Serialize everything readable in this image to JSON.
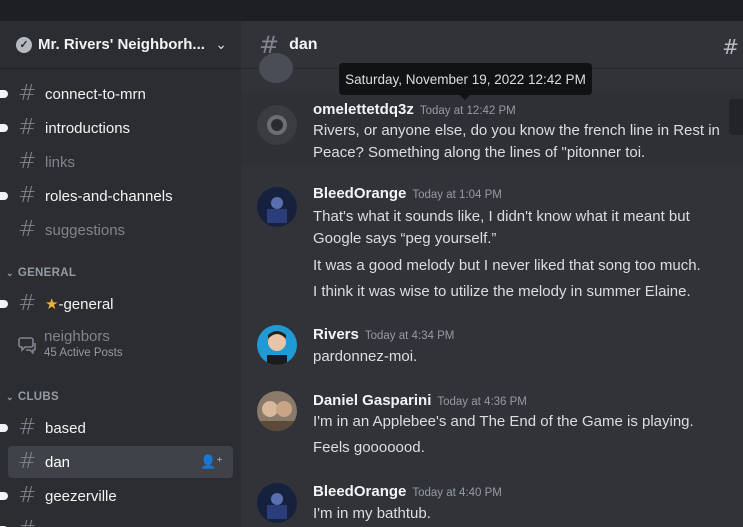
{
  "server": {
    "name": "Mr. Rivers' Neighborh..."
  },
  "sidebar": {
    "channels_top": [
      {
        "label": "connect-to-mrn",
        "unread": true
      },
      {
        "label": "introductions",
        "unread": true
      },
      {
        "label": "links",
        "unread": false
      },
      {
        "label": "roles-and-channels",
        "unread": true
      },
      {
        "label": "suggestions",
        "unread": false
      }
    ],
    "category_general": "GENERAL",
    "general_channel": "-general",
    "forum": {
      "name": "neighbors",
      "sub": "45 Active Posts"
    },
    "category_clubs": "CLUBS",
    "clubs": [
      {
        "label": "based",
        "unread": true
      },
      {
        "label": "dan",
        "selected": true
      },
      {
        "label": "geezerville",
        "unread": true
      }
    ]
  },
  "channel": {
    "name": "dan"
  },
  "tooltip": {
    "text": "Saturday, November 19, 2022 12:42 PM"
  },
  "messages": [
    {
      "author": "omelettetdq3z",
      "time": "Today at 12:42 PM",
      "lines": [
        "Rivers, or anyone else, do you know the french line in Rest in",
        "Peace? Something along the lines of \"pitonner toi."
      ]
    },
    {
      "author": "BleedOrange",
      "time": "Today at 1:04 PM",
      "lines": [
        "That's what it sounds like, I didn't know what it meant but",
        "Google says “peg yourself.”",
        "It was a good melody but I never liked that song too much.",
        "I think it was wise to utilize the melody in summer Elaine."
      ]
    },
    {
      "author": "Rivers",
      "time": "Today at 4:34 PM",
      "lines": [
        "pardonnez-moi."
      ]
    },
    {
      "author": "Daniel Gasparini",
      "time": "Today at 4:36 PM",
      "lines": [
        "I'm in an Applebee's and The End of the Game is playing.",
        "Feels gooooood."
      ]
    },
    {
      "author": "BleedOrange",
      "time": "Today at 4:40 PM",
      "lines": [
        "I'm in my bathtub."
      ]
    }
  ],
  "colors": {
    "sidebar_bg": "#2b2d31",
    "main_bg": "#313338",
    "selected_bg": "#404249",
    "text": "#dbdee1"
  }
}
